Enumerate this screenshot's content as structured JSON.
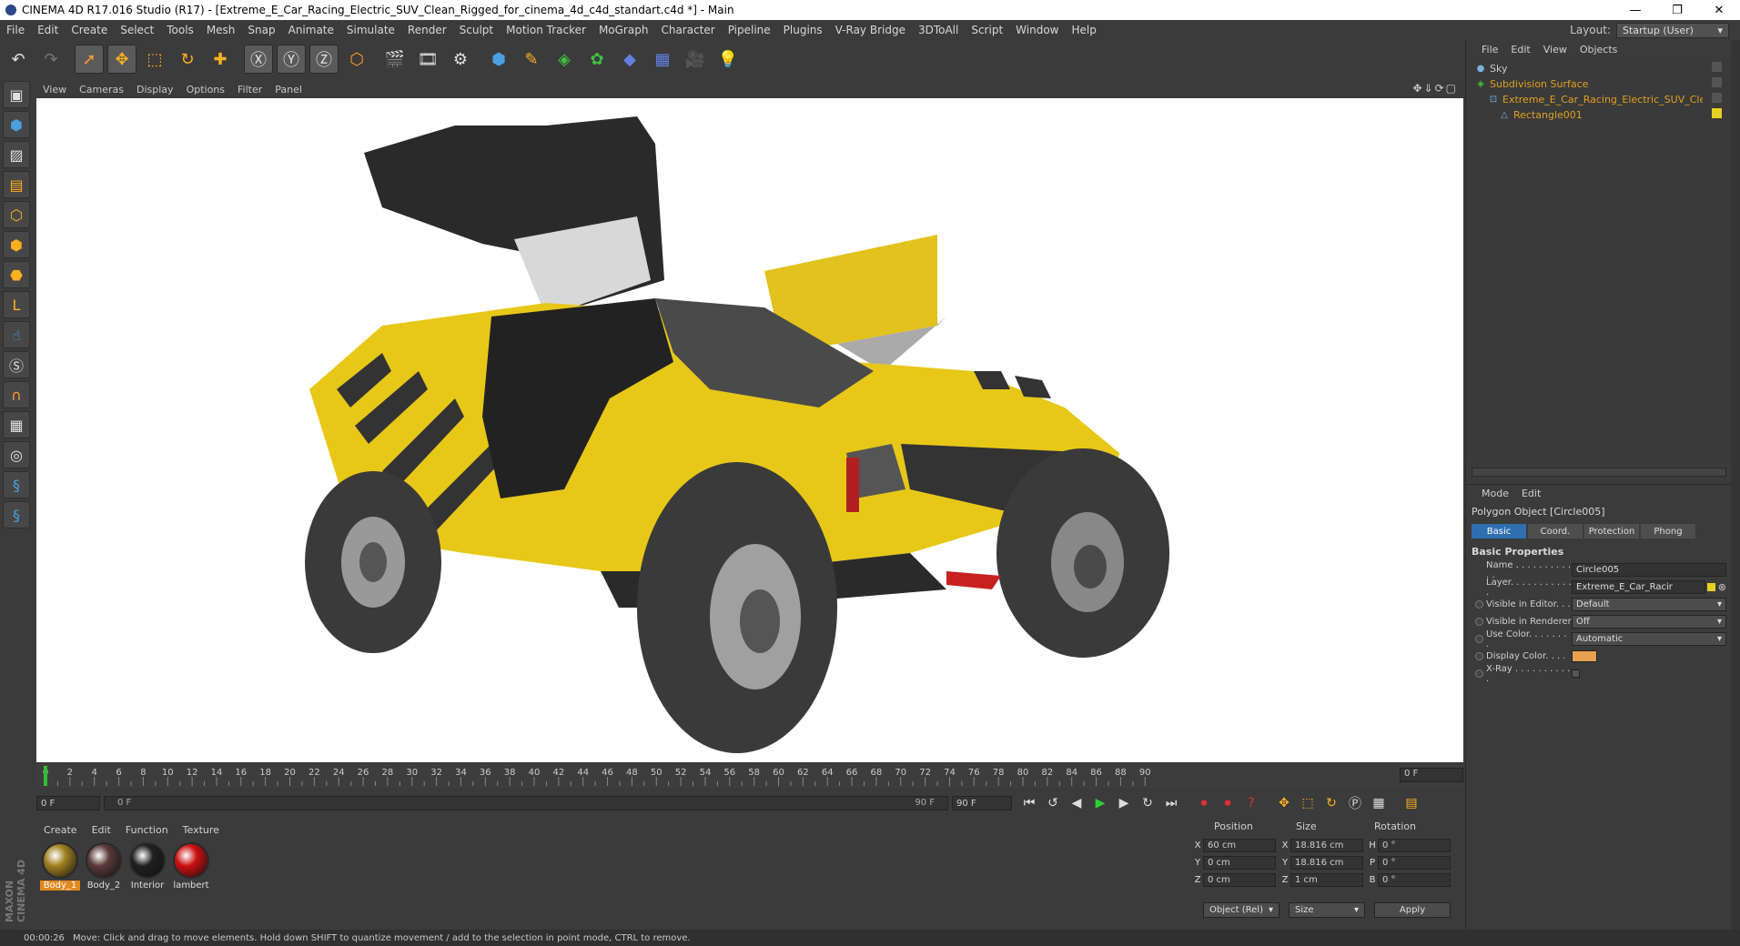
{
  "window": {
    "title": "CINEMA 4D R17.016 Studio (R17) - [Extreme_E_Car_Racing_Electric_SUV_Clean_Rigged_for_cinema_4d_c4d_standart.c4d *] - Main",
    "layout_label": "Layout:",
    "layout_value": "Startup (User)"
  },
  "menubar": [
    "File",
    "Edit",
    "Create",
    "Select",
    "Tools",
    "Mesh",
    "Snap",
    "Animate",
    "Simulate",
    "Render",
    "Sculpt",
    "Motion Tracker",
    "MoGraph",
    "Character",
    "Pipeline",
    "Plugins",
    "V-Ray Bridge",
    "3DToAll",
    "Script",
    "Window",
    "Help"
  ],
  "viewport_menu": [
    "View",
    "Cameras",
    "Display",
    "Options",
    "Filter",
    "Panel"
  ],
  "timeline": {
    "ticks": [
      "0",
      "2",
      "4",
      "6",
      "8",
      "10",
      "12",
      "14",
      "16",
      "18",
      "20",
      "22",
      "24",
      "26",
      "28",
      "30",
      "32",
      "34",
      "36",
      "38",
      "40",
      "42",
      "44",
      "46",
      "48",
      "50",
      "52",
      "54",
      "56",
      "58",
      "60",
      "62",
      "64",
      "66",
      "68",
      "70",
      "72",
      "74",
      "76",
      "78",
      "80",
      "82",
      "84",
      "86",
      "88",
      "90"
    ],
    "current_frame": "0 F"
  },
  "transport": {
    "start": "0 F",
    "range_start": "0 F",
    "range_end": "90 F",
    "end": "90 F"
  },
  "materials": {
    "menu": [
      "Create",
      "Edit",
      "Function",
      "Texture"
    ],
    "items": [
      {
        "label": "Body_1",
        "color": "#a08020"
      },
      {
        "label": "Body_2",
        "color": "#5a3a3a"
      },
      {
        "label": "Interior",
        "color": "#202020"
      },
      {
        "label": "lambert",
        "color": "#cc1010"
      }
    ]
  },
  "coordinates": {
    "headers": [
      "Position",
      "Size",
      "Rotation"
    ],
    "rows": [
      {
        "axis": "X",
        "pos": "60 cm",
        "size_axis": "X",
        "size": "18.816 cm",
        "rot_axis": "H",
        "rot": "0 °"
      },
      {
        "axis": "Y",
        "pos": "0 cm",
        "size_axis": "Y",
        "size": "18.816 cm",
        "rot_axis": "P",
        "rot": "0 °"
      },
      {
        "axis": "Z",
        "pos": "0 cm",
        "size_axis": "Z",
        "size": "1 cm",
        "rot_axis": "B",
        "rot": "0 °"
      }
    ],
    "mode": "Object (Rel)",
    "size_mode": "Size",
    "apply": "Apply"
  },
  "objects": {
    "menu": [
      "File",
      "Edit",
      "View",
      "Objects"
    ],
    "items": [
      {
        "name": "Sky",
        "color": "#c8c8c8"
      },
      {
        "name": "Subdivision Surface",
        "color": "#e0a020"
      },
      {
        "name": "Extreme_E_Car_Racing_Electric_SUV_Clean",
        "color": "#e0a020"
      },
      {
        "name": "Rectangle001",
        "color": "#e0a020"
      }
    ]
  },
  "attributes": {
    "menu": [
      "Mode",
      "Edit"
    ],
    "title": "Polygon Object [Circle005]",
    "tabs": [
      "Basic",
      "Coord.",
      "Protection",
      "Phong"
    ],
    "section": "Basic Properties",
    "props": [
      {
        "label": "Name . . . . . . . . . . . .",
        "value": "Circle005"
      },
      {
        "label": "Layer. . . . . . . . . . . .",
        "value": "Extreme_E_Car_Racir"
      },
      {
        "label": "Visible in Editor. . .",
        "value": "Default"
      },
      {
        "label": "Visible in Renderer",
        "value": "Off"
      },
      {
        "label": "Use Color. . . . . . . .",
        "value": "Automatic"
      },
      {
        "label": "Display Color. . . .",
        "value": ""
      },
      {
        "label": "X-Ray . . . . . . . . . . .",
        "value": ""
      }
    ],
    "display_color": "#e8a050"
  },
  "status": {
    "time": "00:00:26",
    "message": "Move: Click and drag to move elements. Hold down SHIFT to quantize movement / add to the selection in point mode, CTRL to remove."
  },
  "brand": "MAXON CINEMA 4D"
}
